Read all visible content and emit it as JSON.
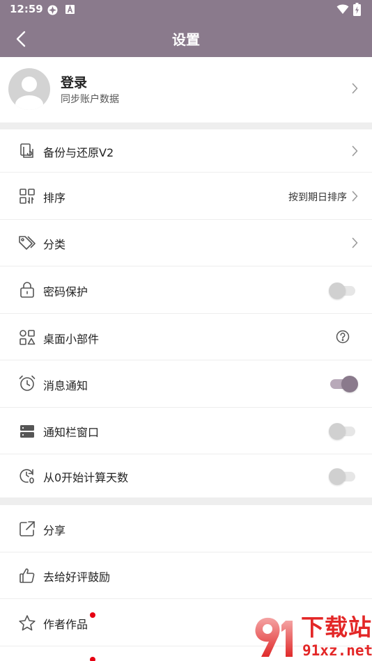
{
  "status_bar": {
    "time": "12:59"
  },
  "app_bar": {
    "title": "设置"
  },
  "login": {
    "title": "登录",
    "subtitle": "同步账户数据"
  },
  "settings": [
    {
      "label": "备份与还原V2"
    },
    {
      "label": "排序",
      "value": "按到期日排序"
    },
    {
      "label": "分类"
    },
    {
      "label": "密码保护",
      "toggle": false
    },
    {
      "label": "桌面小部件"
    },
    {
      "label": "消息通知",
      "toggle": true
    },
    {
      "label": "通知栏窗口",
      "toggle": false
    },
    {
      "label": "从0开始计算天数",
      "toggle": false
    }
  ],
  "more": [
    {
      "label": "分享"
    },
    {
      "label": "去给好评鼓励"
    },
    {
      "label": "作者作品",
      "badge": "red-dot"
    }
  ],
  "watermark": {
    "brand": "下载站",
    "url": "91xz.net"
  },
  "colors": {
    "accent": "#8a7a8c",
    "divider": "#eeeeee",
    "badge": "#e60012"
  }
}
